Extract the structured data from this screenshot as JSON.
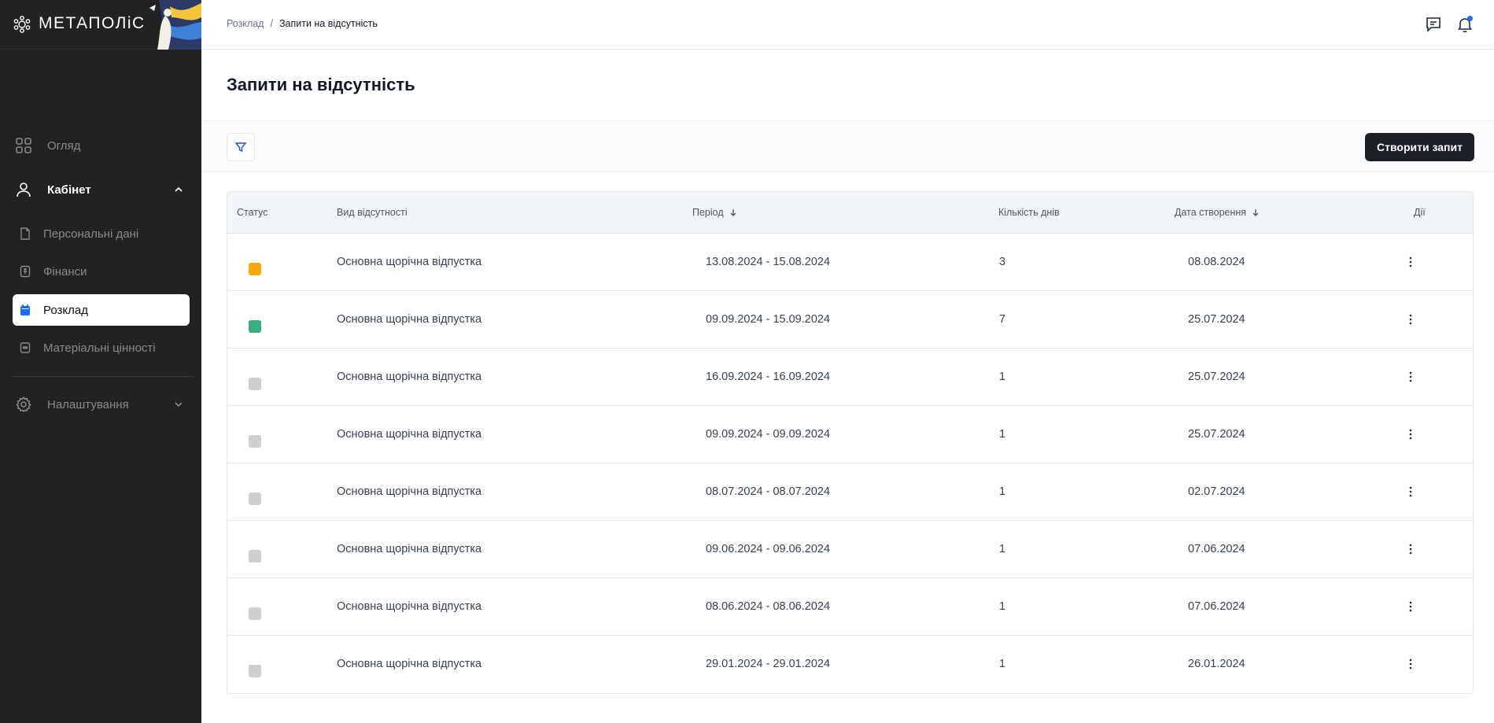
{
  "app": {
    "logo_text": "МЕТАПОЛіС"
  },
  "sidebar": {
    "items": [
      {
        "label": "Огляд",
        "icon": "grid-icon"
      },
      {
        "label": "Кабінет",
        "icon": "user-icon"
      },
      {
        "label": "Персональні дані",
        "icon": "document-icon"
      },
      {
        "label": "Фінанси",
        "icon": "finance-icon"
      },
      {
        "label": "Розклад",
        "icon": "calendar-icon"
      },
      {
        "label": "Матеріальні цінності",
        "icon": "assets-icon"
      },
      {
        "label": "Налаштування",
        "icon": "gear-icon"
      }
    ]
  },
  "breadcrumb": {
    "items": [
      "Розклад",
      "Запити на відсутність"
    ],
    "separator": "/"
  },
  "page": {
    "title": "Запити на відсутність"
  },
  "toolbar": {
    "create_label": "Створити запит"
  },
  "table": {
    "columns": [
      "Статус",
      "Вид відсутності",
      "Період",
      "Кількість днів",
      "Дата створення",
      "Дії"
    ],
    "rows": [
      {
        "status_color": "#f5a90a",
        "type": "Основна щорічна відпустка",
        "period": "13.08.2024 - 15.08.2024",
        "days": "3",
        "created": "08.08.2024"
      },
      {
        "status_color": "#3aaf7d",
        "type": "Основна щорічна відпустка",
        "period": "09.09.2024 - 15.09.2024",
        "days": "7",
        "created": "25.07.2024"
      },
      {
        "status_color": "#cfcfcf",
        "type": "Основна щорічна відпустка",
        "period": "16.09.2024 - 16.09.2024",
        "days": "1",
        "created": "25.07.2024"
      },
      {
        "status_color": "#cfcfcf",
        "type": "Основна щорічна відпустка",
        "period": "09.09.2024 - 09.09.2024",
        "days": "1",
        "created": "25.07.2024"
      },
      {
        "status_color": "#cfcfcf",
        "type": "Основна щорічна відпустка",
        "period": "08.07.2024 - 08.07.2024",
        "days": "1",
        "created": "02.07.2024"
      },
      {
        "status_color": "#cfcfcf",
        "type": "Основна щорічна відпустка",
        "period": "09.06.2024 - 09.06.2024",
        "days": "1",
        "created": "07.06.2024"
      },
      {
        "status_color": "#cfcfcf",
        "type": "Основна щорічна відпустка",
        "period": "08.06.2024 - 08.06.2024",
        "days": "1",
        "created": "07.06.2024"
      },
      {
        "status_color": "#cfcfcf",
        "type": "Основна щорічна відпустка",
        "period": "29.01.2024 - 29.01.2024",
        "days": "1",
        "created": "26.01.2024"
      }
    ]
  },
  "colors": {
    "sidebar_bg": "#222222",
    "accent": "#1d6ef5",
    "primary_button": "#1c1f26"
  }
}
